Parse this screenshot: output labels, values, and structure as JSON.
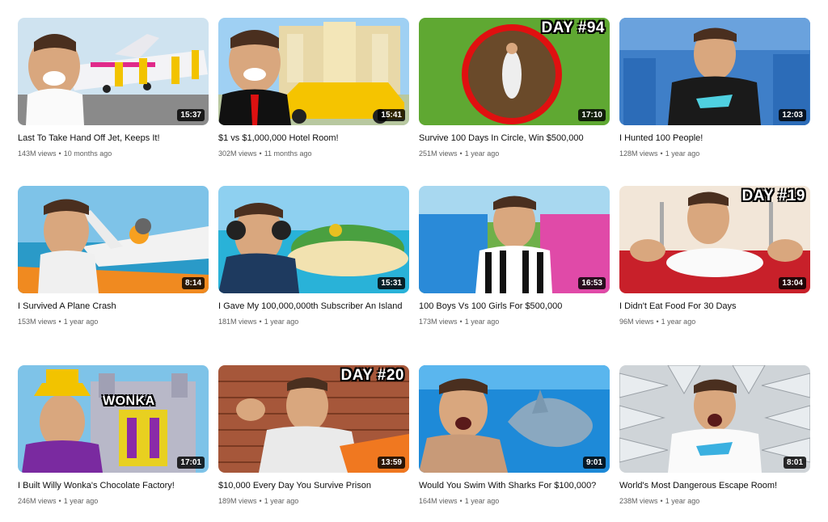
{
  "videos": [
    {
      "title": "Last To Take Hand Off Jet, Keeps It!",
      "views": "143M views",
      "age": "10 months ago",
      "duration": "15:37",
      "overlay": ""
    },
    {
      "title": "$1 vs $1,000,000 Hotel Room!",
      "views": "302M views",
      "age": "11 months ago",
      "duration": "15:41",
      "overlay": ""
    },
    {
      "title": "Survive 100 Days In Circle, Win $500,000",
      "views": "251M views",
      "age": "1 year ago",
      "duration": "17:10",
      "overlay": "DAY #94"
    },
    {
      "title": "I Hunted 100 People!",
      "views": "128M views",
      "age": "1 year ago",
      "duration": "12:03",
      "overlay": ""
    },
    {
      "title": "I Survived A Plane Crash",
      "views": "153M views",
      "age": "1 year ago",
      "duration": "8:14",
      "overlay": ""
    },
    {
      "title": "I Gave My 100,000,000th Subscriber An Island",
      "views": "181M views",
      "age": "1 year ago",
      "duration": "15:31",
      "overlay": ""
    },
    {
      "title": "100 Boys Vs 100 Girls For $500,000",
      "views": "173M views",
      "age": "1 year ago",
      "duration": "16:53",
      "overlay": ""
    },
    {
      "title": "I Didn't Eat Food For 30 Days",
      "views": "96M views",
      "age": "1 year ago",
      "duration": "13:04",
      "overlay": "DAY #19"
    },
    {
      "title": "I Built Willy Wonka's Chocolate Factory!",
      "views": "246M views",
      "age": "1 year ago",
      "duration": "17:01",
      "overlay": "WONKA"
    },
    {
      "title": "$10,000 Every Day You Survive Prison",
      "views": "189M views",
      "age": "1 year ago",
      "duration": "13:59",
      "overlay": "DAY #20"
    },
    {
      "title": "Would You Swim With Sharks For $100,000?",
      "views": "164M views",
      "age": "1 year ago",
      "duration": "9:01",
      "overlay": ""
    },
    {
      "title": "World's Most Dangerous Escape Room!",
      "views": "238M views",
      "age": "1 year ago",
      "duration": "8:01",
      "overlay": ""
    }
  ],
  "meta_separator": "•"
}
